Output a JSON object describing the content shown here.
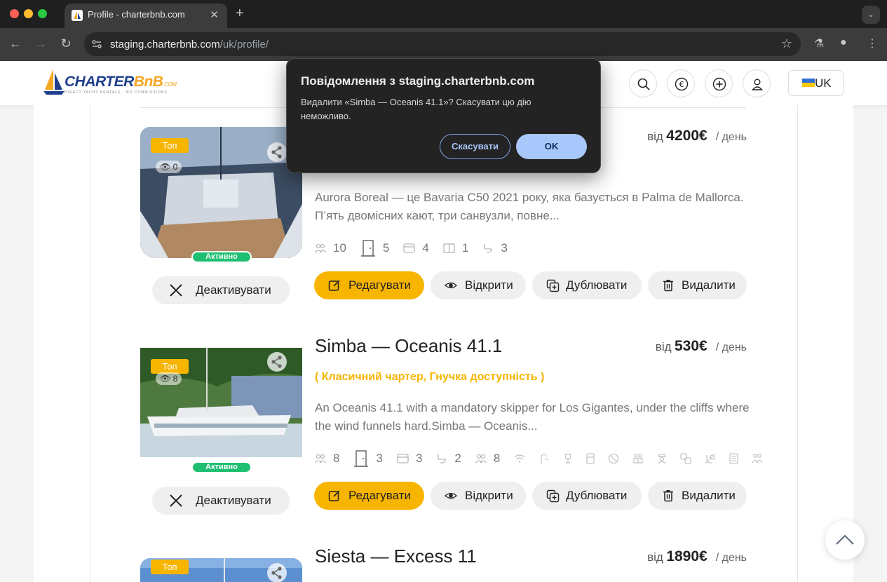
{
  "browser": {
    "tab_title": "Profile - charterbnb.com",
    "url_host": "staging.charterbnb.com",
    "url_path": "/uk/profile/"
  },
  "header": {
    "logo_main": "CHARTER",
    "logo_accent": "BnB",
    "logo_suffix": ".COM",
    "logo_tagline": "DIRECT YACHT RENTALS · NO COMMISSIONS",
    "language": "UK"
  },
  "actions": {
    "edit": "Редагувати",
    "open": "Відкрити",
    "duplicate": "Дублювати",
    "delete": "Видалити",
    "deactivate": "Деактивувати"
  },
  "price_from": "від",
  "price_per": "/ день",
  "listings": [
    {
      "badge": "Топ",
      "views": "0",
      "status": "Активно",
      "price": "4200€",
      "description": "Aurora Boreal — це Bavaria C50 2021 року, яка базується в Palma de Mallorca. П’ять двомісних кают, три санвузли, повне...",
      "features": [
        "10",
        "5",
        "4",
        "1",
        "3"
      ]
    },
    {
      "badge": "Топ",
      "views": "8",
      "status": "Активно",
      "title": "Simba — Oceanis 41.1",
      "price": "530€",
      "charter_type": "( Класичний чартер, Гнучка доступність )",
      "description": "An Oceanis 41.1 with a mandatory skipper for Los Gigantes, under the cliffs where the wind funnels hard.Simba — Oceanis...",
      "features": [
        "8",
        "3",
        "3",
        "2",
        "8"
      ]
    },
    {
      "badge": "Топ",
      "title": "Siesta — Excess 11",
      "price": "1890€"
    }
  ],
  "dialog": {
    "title": "Повідомлення з staging.charterbnb.com",
    "message": "Видалити «Simba — Oceanis 41.1»? Скасувати цю дію неможливо.",
    "cancel": "Скасувати",
    "ok": "OK"
  }
}
